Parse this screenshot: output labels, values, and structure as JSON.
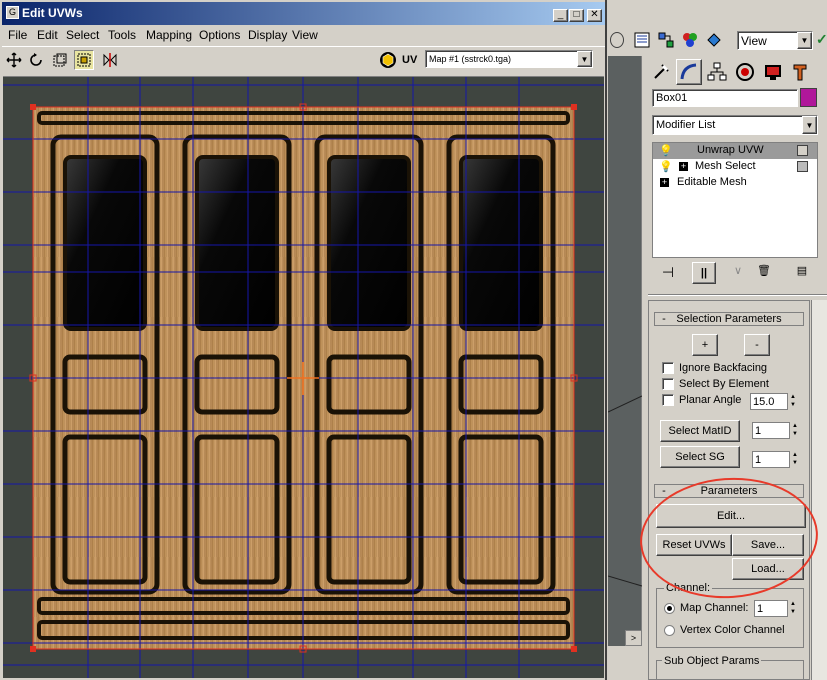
{
  "window": {
    "title": "Edit UVWs",
    "minimize": "_",
    "maximize": "□",
    "close": "✕"
  },
  "menu": [
    "File",
    "Edit",
    "Select",
    "Tools",
    "Mapping",
    "Options",
    "Display",
    "View"
  ],
  "toolbar": {
    "tools": [
      "move-icon",
      "rotate-icon",
      "scale-icon",
      "freeform-icon",
      "mirror-icon"
    ],
    "uv_label": "UV",
    "map_select": "Map #1 (sstrck0.tga)"
  },
  "right_toolbar": {
    "view_select": "View"
  },
  "command_panel": {
    "tabs": [
      "create-icon",
      "modify-icon",
      "hierarchy-icon",
      "motion-icon",
      "display-icon",
      "utilities-icon"
    ],
    "object_name": "Box01",
    "object_color": "#b0179a",
    "modifier_list_label": "Modifier List",
    "stack": [
      {
        "label": "Unwrap UVW",
        "selected": true
      },
      {
        "label": "Mesh Select",
        "selected": false
      },
      {
        "label": "Editable Mesh",
        "selected": false
      }
    ],
    "selection_params": {
      "header": "Selection Parameters",
      "collapse": "-",
      "plus": "+",
      "minus": "-",
      "ignore_backfacing": "Ignore Backfacing",
      "select_by_element": "Select By Element",
      "planar_angle": "Planar Angle",
      "planar_angle_value": "15.0",
      "select_matid": "Select MatID",
      "matid_value": "1",
      "select_sg": "Select SG",
      "sg_value": "1"
    },
    "parameters": {
      "header": "Parameters",
      "collapse": "-",
      "edit": "Edit...",
      "reset_uvws": "Reset UVWs",
      "save": "Save...",
      "load": "Load...",
      "channel_label": "Channel:",
      "map_channel": "Map Channel:",
      "map_channel_value": "1",
      "vertex_color_channel": "Vertex Color Channel",
      "sub_object_params": "Sub Object Params"
    }
  }
}
